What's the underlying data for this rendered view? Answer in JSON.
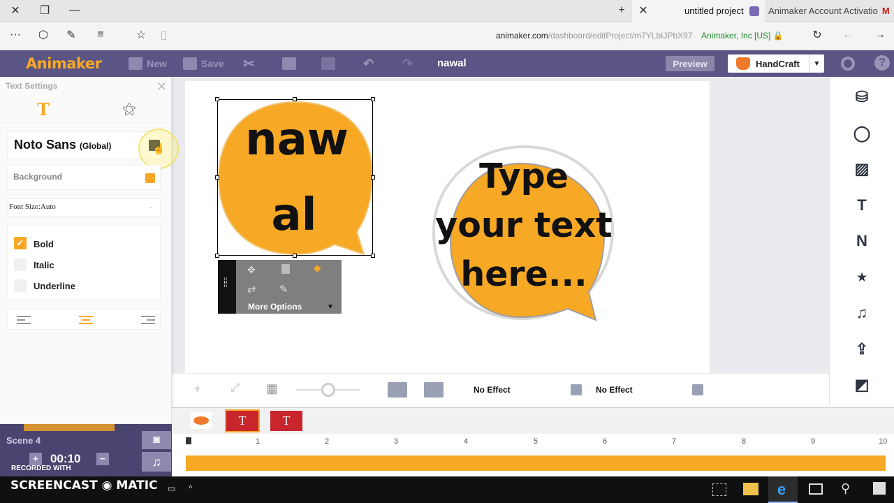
{
  "browser": {
    "active_tab_title": "untitled project",
    "second_tab_title": "Animaker Account Activatio",
    "url_host": "animaker.com",
    "url_path": "/dashboard/editProject/m7YLbIJPbX97",
    "security_label": "Animaker, Inc [US]"
  },
  "app": {
    "logo": "Animaker",
    "toolbar": {
      "new_label": "New",
      "save_label": "Save"
    },
    "project_name": "nawal",
    "preview_label": "Preview",
    "mode_label": "HandCraft",
    "help_label": "?"
  },
  "text_settings": {
    "title": "Text Settings",
    "tab_text_icon": "T",
    "font_name": "Noto Sans",
    "font_scope": "(Global)",
    "background_label": "Background",
    "background_color": "#f7a825",
    "font_size_label": "Font Size:Auto",
    "styles": [
      {
        "label": "Bold",
        "checked": true
      },
      {
        "label": "Italic",
        "checked": false
      },
      {
        "label": "Underline",
        "checked": false
      }
    ]
  },
  "canvas": {
    "bubble1_line1": "naw",
    "bubble1_line2": "al",
    "bubble2_line1": "Type",
    "bubble2_line2": "your text",
    "bubble2_line3": "here...",
    "more_options_label": "More Options",
    "accent_color": "#f7a825"
  },
  "bottom_controls": {
    "enter_effect": "No Effect",
    "exit_effect": "No Effect"
  },
  "timeline": {
    "track_text_icon": "T",
    "ticks": [
      "1",
      "2",
      "3",
      "4",
      "5",
      "6",
      "7",
      "8",
      "9",
      "10"
    ],
    "scene_label": "Scene 4",
    "duration": "00:10",
    "plus": "+",
    "minus": "−"
  },
  "watermark": {
    "recorded_with": "RECORDED WITH",
    "brand": "SCREENCAST ◉ MATIC"
  }
}
